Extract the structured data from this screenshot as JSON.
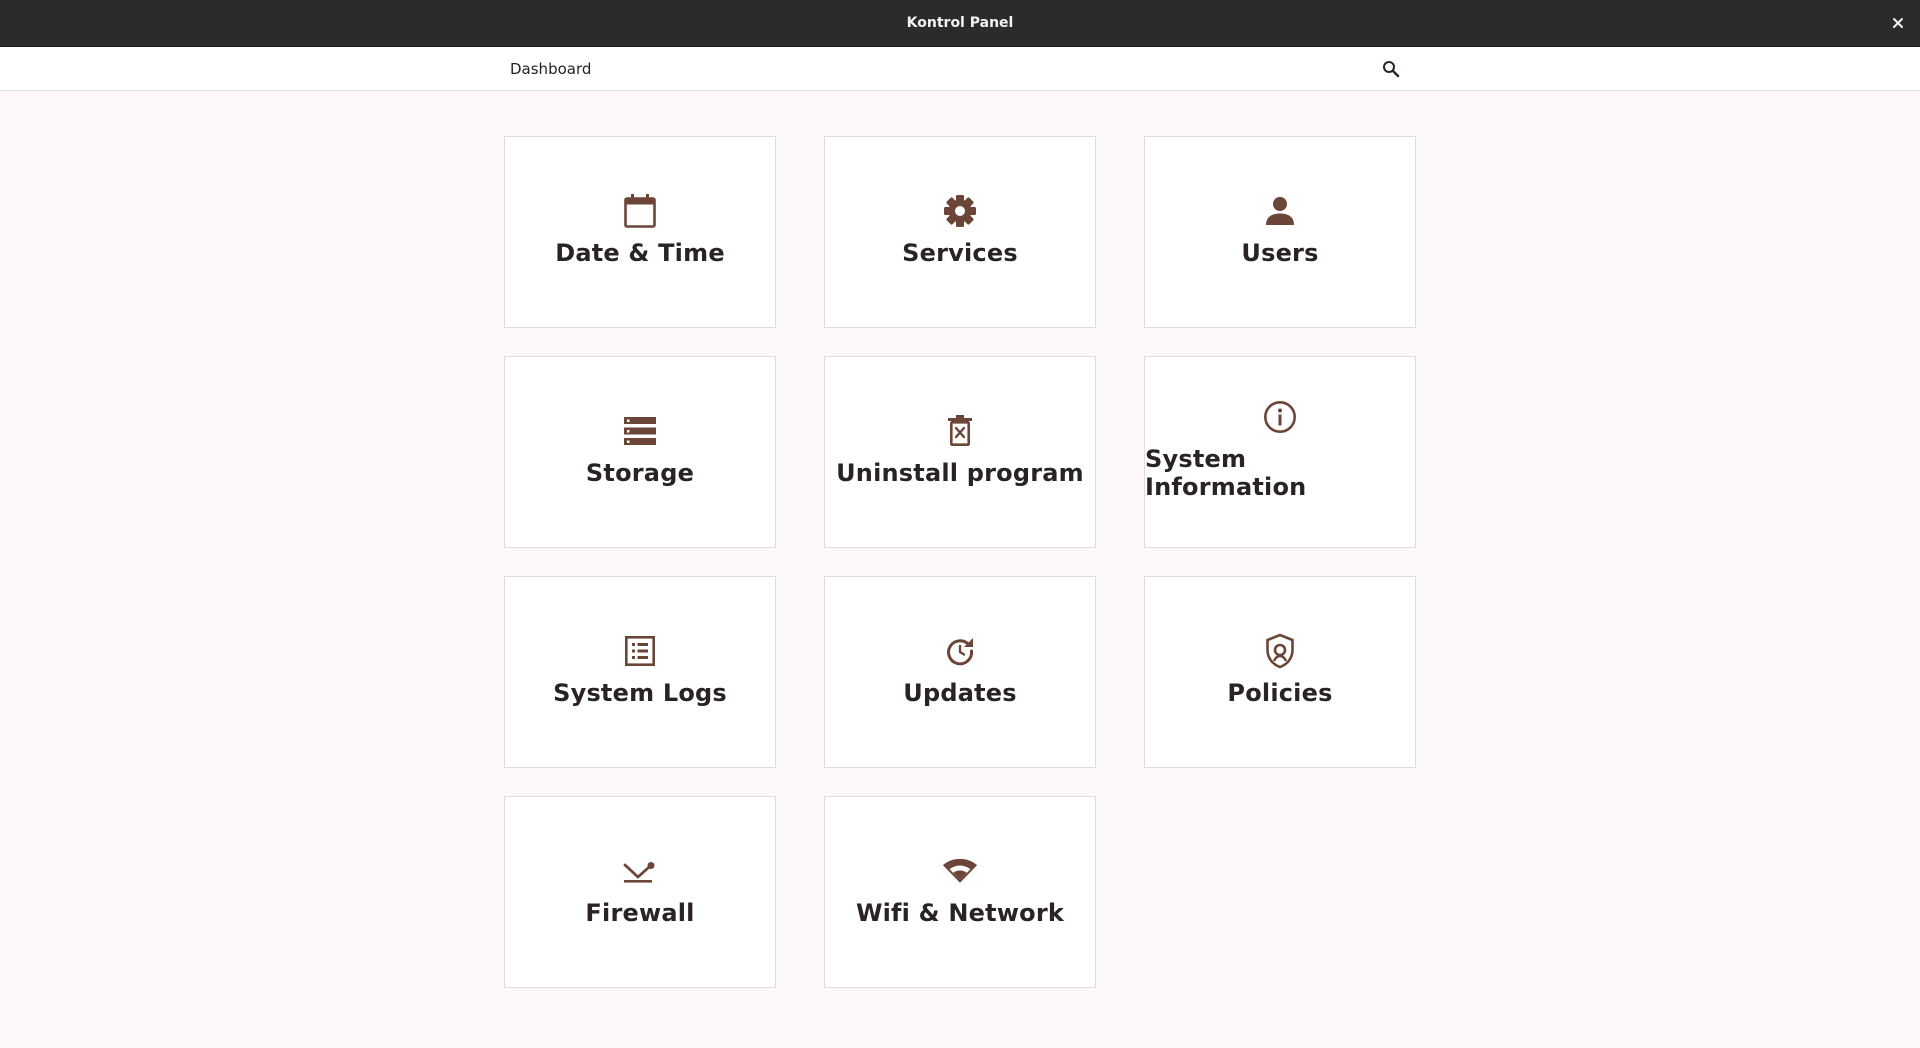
{
  "window": {
    "title": "Kontrol Panel",
    "close_icon": "close-icon"
  },
  "topbar": {
    "breadcrumb": "Dashboard",
    "search_icon": "search-icon"
  },
  "colors": {
    "accent": "#6b4538",
    "titlebar": "#2b2b2b",
    "background": "#fdf8fb"
  },
  "tiles": [
    {
      "label": "Date & Time",
      "icon": "calendar-icon"
    },
    {
      "label": "Services",
      "icon": "gear-icon"
    },
    {
      "label": "Users",
      "icon": "person-icon"
    },
    {
      "label": "Storage",
      "icon": "storage-icon"
    },
    {
      "label": "Uninstall program",
      "icon": "trash-icon"
    },
    {
      "label": "System Information",
      "icon": "info-icon"
    },
    {
      "label": "System Logs",
      "icon": "list-icon"
    },
    {
      "label": "Updates",
      "icon": "refresh-icon"
    },
    {
      "label": "Policies",
      "icon": "shield-icon"
    },
    {
      "label": "Firewall",
      "icon": "firewall-icon"
    },
    {
      "label": "Wifi & Network",
      "icon": "wifi-icon"
    }
  ]
}
